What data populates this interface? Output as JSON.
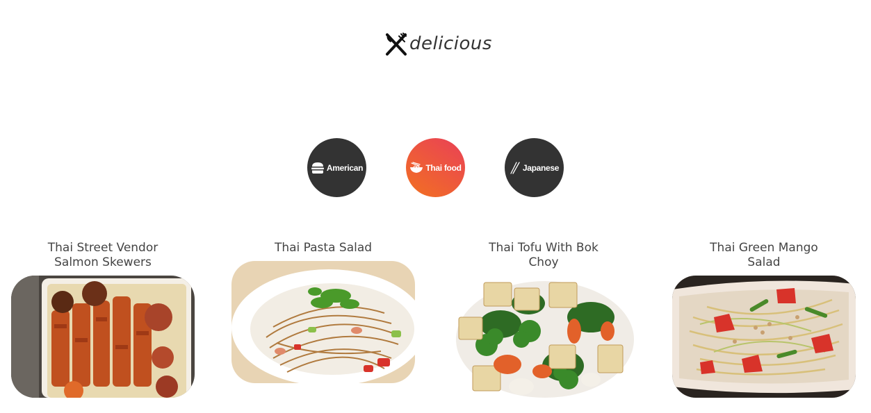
{
  "header": {
    "logo_text": "delicious",
    "logo_icon": "fork-knife-icon"
  },
  "cuisines": [
    {
      "label": "American",
      "icon": "burger-icon",
      "active": false
    },
    {
      "label": "Thai food",
      "icon": "noodle-bowl-icon",
      "active": true
    },
    {
      "label": "Japanese",
      "icon": "chopsticks-icon",
      "active": false
    }
  ],
  "colors": {
    "button_dark": "#333333",
    "active_gradient_start": "#f27121",
    "active_gradient_end": "#e94057"
  },
  "recipes": [
    {
      "title": "Thai Street Vendor Salmon Skewers"
    },
    {
      "title": "Thai Pasta Salad"
    },
    {
      "title": "Thai Tofu With Bok Choy"
    },
    {
      "title": "Thai Green Mango Salad"
    }
  ]
}
